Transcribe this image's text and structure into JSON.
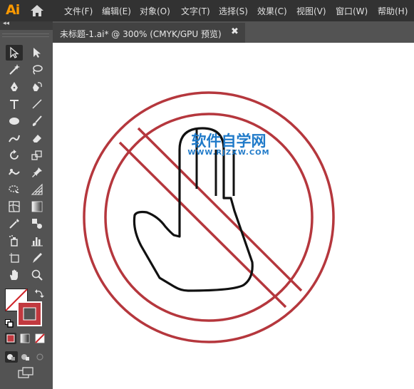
{
  "app": {
    "logo": "Ai"
  },
  "menu": [
    {
      "label": "文件(F)"
    },
    {
      "label": "编辑(E)"
    },
    {
      "label": "对象(O)"
    },
    {
      "label": "文字(T)"
    },
    {
      "label": "选择(S)"
    },
    {
      "label": "效果(C)"
    },
    {
      "label": "视图(V)"
    },
    {
      "label": "窗口(W)"
    },
    {
      "label": "帮助(H)"
    }
  ],
  "toolbar": {
    "collapse": "◂◂"
  },
  "document_tab": {
    "title": "未标题-1.ai* @ 300% (CMYK/GPU 预览)",
    "close": "✖"
  },
  "watermark": {
    "title": "软件自学网",
    "url": "WWW.RJZXW.COM"
  },
  "colors": {
    "accent": "#ff9a00",
    "stroke_red": "#b5373d",
    "fill_red": "#c1393f",
    "watermark_blue": "#1f7ac9"
  }
}
